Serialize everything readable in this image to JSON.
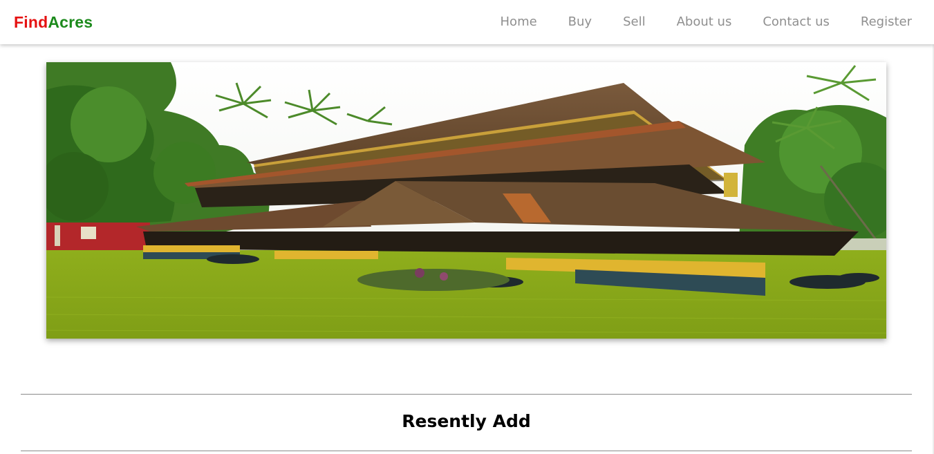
{
  "brand": {
    "part1": "Find",
    "part2": "Acres",
    "color_part1": "#e51212",
    "color_part2": "#1c8a1c"
  },
  "nav": {
    "items": [
      {
        "label": "Home"
      },
      {
        "label": "Buy"
      },
      {
        "label": "Sell"
      },
      {
        "label": "About us"
      },
      {
        "label": "Contact us"
      },
      {
        "label": "Register"
      }
    ],
    "link_color": "#8f8f8f"
  },
  "hero": {
    "image_subject": "traditional-kerala-house-with-tiled-roofs-lawn-and-palm-trees"
  },
  "recent_section": {
    "title": "Resently Add"
  }
}
